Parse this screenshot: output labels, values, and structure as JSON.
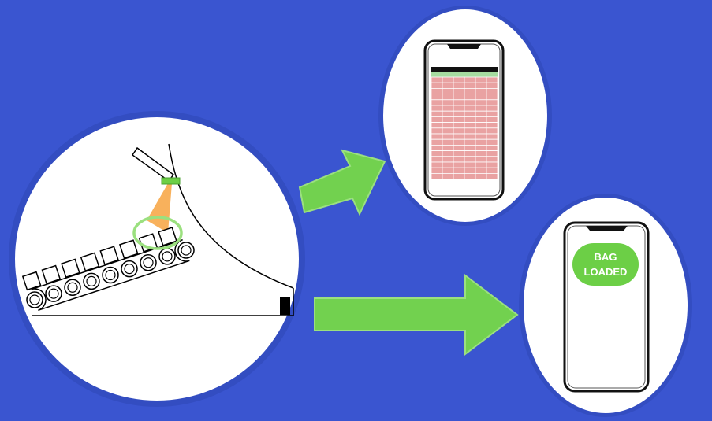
{
  "colors": {
    "background": "#3a55d0",
    "circle_fill": "#ffffff",
    "circle_ring": "#2f47b8",
    "arrow": "#72d14f",
    "sensor": "#6ccf46",
    "beam": "#f7a94a",
    "highlight_ring": "#9be07f",
    "table_cell": "#e9a2a2",
    "table_header_green": "#a6dca0",
    "badge": "#6ccf46",
    "line": "#000000"
  },
  "icons": {
    "conveyor": "conveyor-belt-icon",
    "sensor": "scanner-sensor-icon",
    "phone_table": "smartphone-table-icon",
    "phone_status": "smartphone-status-icon",
    "arrow": "right-arrow-icon"
  },
  "status_badge": {
    "line1": "BAG",
    "line2": "LOADED"
  },
  "table": {
    "columns": 6,
    "rows": 18
  }
}
